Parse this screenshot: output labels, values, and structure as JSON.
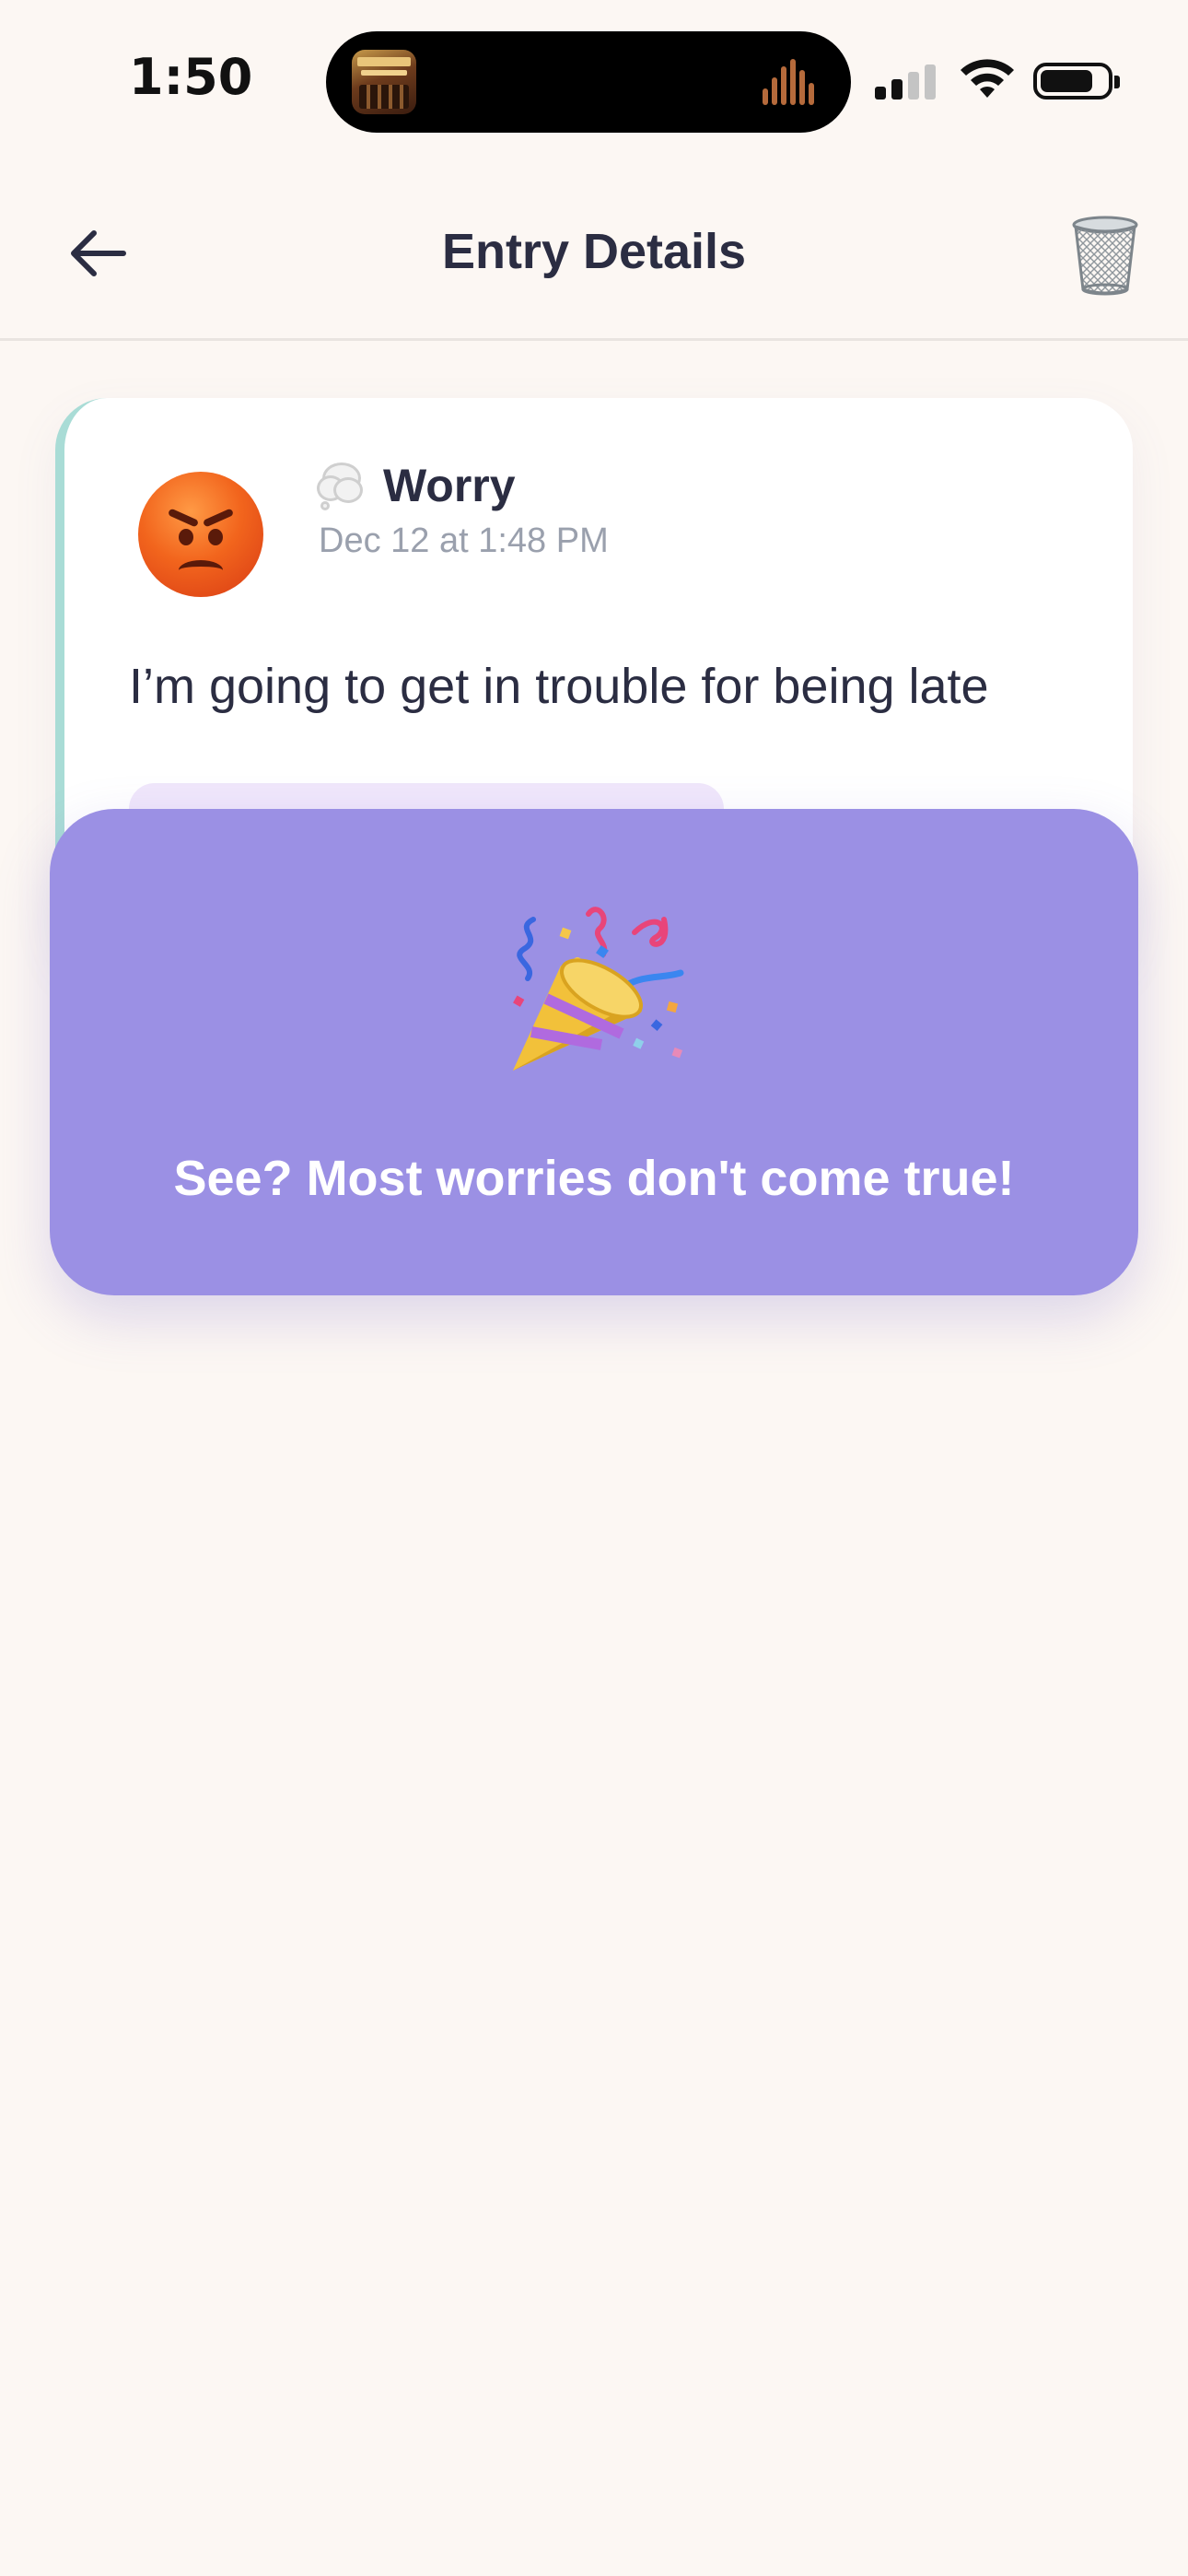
{
  "status_bar": {
    "time": "1:50"
  },
  "header": {
    "title": "Entry Details",
    "back_icon": "arrow-left-icon",
    "trash_icon": "trash-can-icon"
  },
  "entry": {
    "mood_icon": "angry-face-icon",
    "type_icon": "thought-bubble-icon",
    "type": "Worry",
    "date": "Dec 12 at 1:48 PM",
    "text": "I’m going to get in trouble for being late"
  },
  "celebration": {
    "icon": "party-popper-icon",
    "message": "See? Most worries don't come true!"
  },
  "colors": {
    "background": "#fcf7f3",
    "card_accent": "#a9dcd6",
    "overlay": "#9b90e4",
    "title_text": "#2b2d42",
    "muted_text": "#9aa0ad"
  }
}
